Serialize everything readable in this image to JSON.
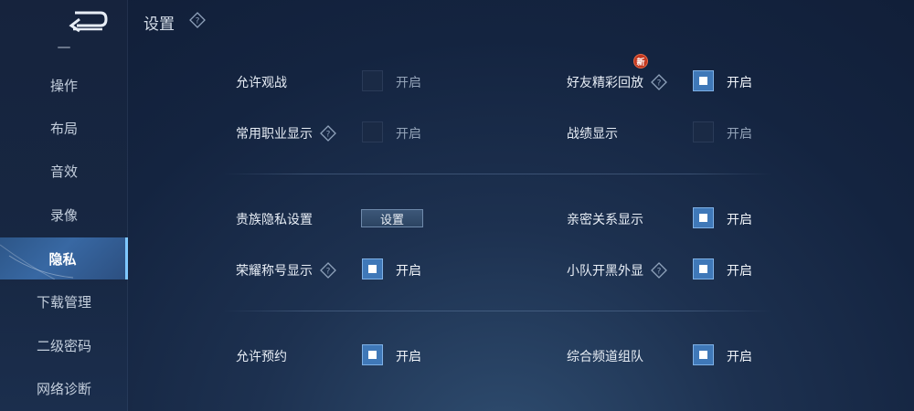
{
  "header": {
    "title": "设置"
  },
  "sidebar": {
    "items": [
      {
        "id": "partial",
        "label": "—"
      },
      {
        "id": "operation",
        "label": "操作"
      },
      {
        "id": "layout",
        "label": "布局"
      },
      {
        "id": "sound",
        "label": "音效"
      },
      {
        "id": "recording",
        "label": "录像"
      },
      {
        "id": "privacy",
        "label": "隐私"
      },
      {
        "id": "downloads",
        "label": "下载管理"
      },
      {
        "id": "second-password",
        "label": "二级密码"
      },
      {
        "id": "network",
        "label": "网络诊断"
      }
    ]
  },
  "settings": {
    "allow_spectate": {
      "label": "允许观战",
      "state": "开启",
      "on": false
    },
    "friend_highlights": {
      "label": "好友精彩回放",
      "state": "开启",
      "on": true,
      "badge": "新"
    },
    "common_roles": {
      "label": "常用职业显示",
      "state": "开启",
      "on": false
    },
    "battle_record": {
      "label": "战绩显示",
      "state": "开启",
      "on": false
    },
    "noble_privacy": {
      "label": "贵族隐私设置",
      "button": "设置"
    },
    "intimate_relation": {
      "label": "亲密关系显示",
      "state": "开启",
      "on": true
    },
    "honor_title": {
      "label": "荣耀称号显示",
      "state": "开启",
      "on": true
    },
    "squad_display": {
      "label": "小队开黑外显",
      "state": "开启",
      "on": true
    },
    "allow_reservation": {
      "label": "允许预约",
      "state": "开启",
      "on": true
    },
    "channel_team": {
      "label": "综合频道组队",
      "state": "开启",
      "on": true
    }
  },
  "colors": {
    "accent": "#3f78b8",
    "active_tab": "#3868a3",
    "badge": "#c2371f"
  },
  "icons": {
    "back": "back-arrow-icon",
    "help": "question-diamond-icon"
  }
}
